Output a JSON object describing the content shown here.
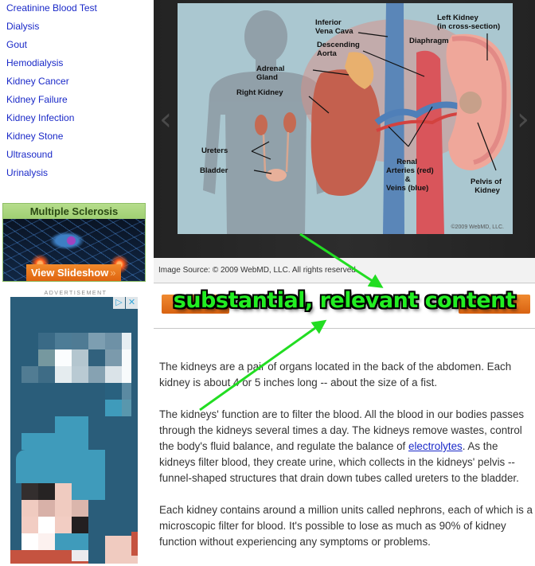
{
  "sidebar": {
    "links": [
      "Creatinine Blood Test",
      "Dialysis",
      "Gout",
      "Hemodialysis",
      "Kidney Cancer",
      "Kidney Failure",
      "Kidney Infection",
      "Kidney Stone",
      "Ultrasound",
      "Urinalysis"
    ],
    "promo": {
      "title": "Multiple Sclerosis",
      "button_label": "View Slideshow",
      "button_icon": "double-chevron-right-icon",
      "button_glyph": "»"
    },
    "ad": {
      "label": "ADVERTISEMENT",
      "adchoices_glyph": "▷",
      "close_glyph": "✕"
    }
  },
  "slideshow": {
    "prev_glyph": "‹",
    "next_glyph": "›",
    "labels": {
      "inferior_vena_cava": "Inferior\nVena Cava",
      "descending_aorta": "Descending\nAorta",
      "adrenal_gland": "Adrenal\nGland",
      "right_kidney": "Right Kidney",
      "ureters": "Ureters",
      "bladder": "Bladder",
      "left_kidney": "Left Kidney\n(in cross-section)",
      "diaphragm": "Diaphragm",
      "renal_vessels": "     Renal\nArteries (red)\n         &\nVeins (blue)",
      "pelvis": "Pelvis of\n  Kidney"
    },
    "image_copyright": "©2009 WebMD, LLC.",
    "caption": "Image Source: © 2009 WebMD, LLC. All rights reserved."
  },
  "annotation": {
    "banner": "substantial, relevant content",
    "arrow_color": "#22dd22"
  },
  "article": {
    "p1": "The kidneys are a pair of organs located in the back of the abdomen. Each kidney is about 4 or 5 inches long -- about the size of a fist.",
    "p2_before": "The kidneys' function are to filter the blood. All the blood in our bodies passes through the kidneys several times a day. The kidneys remove wastes, control the body's fluid balance, and regulate the balance of ",
    "p2_link": "electrolytes",
    "p2_after": ". As the kidneys filter blood, they create urine, which collects in the kidneys' pelvis -- funnel-shaped structures that drain down tubes called ureters to the bladder.",
    "p3": "Each kidney contains around a million units called nephrons, each of which is a microscopic filter for blood. It's possible to lose as much as 90% of kidney function without experiencing any symptoms or problems."
  },
  "colors": {
    "link": "#1a29c8",
    "promo_green": "#9fcf72",
    "orange": "#e06a16",
    "banner_green": "#22ee22"
  }
}
